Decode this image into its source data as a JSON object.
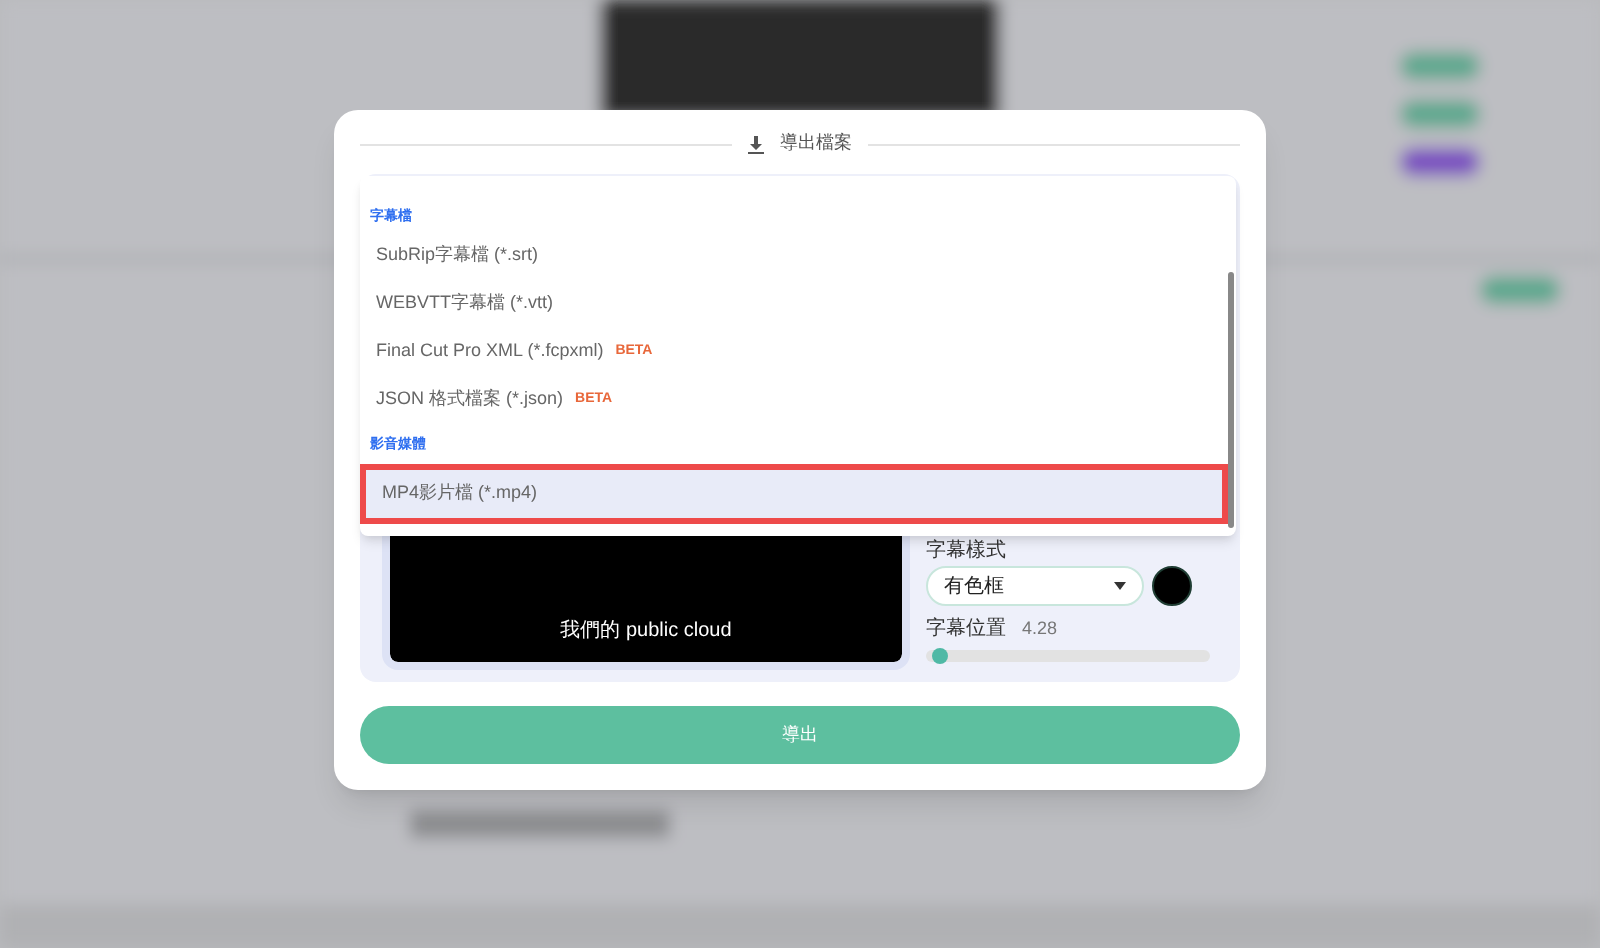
{
  "dialog": {
    "title": "導出檔案",
    "menu": {
      "groups": [
        {
          "label": "字幕檔",
          "items": [
            {
              "label": "SubRip字幕檔 (*.srt)",
              "selected": false
            },
            {
              "label": "WEBVTT字幕檔 (*.vtt)",
              "selected": false
            },
            {
              "label": "Final Cut Pro XML (*.fcpxml)",
              "badge": "BETA",
              "selected": false
            },
            {
              "label": "JSON 格式檔案 (*.json)",
              "badge": "BETA",
              "selected": false
            }
          ]
        },
        {
          "label": "影音媒體",
          "items": [
            {
              "label": "MP4影片檔 (*.mp4)",
              "selected": true
            }
          ]
        }
      ]
    },
    "preview": {
      "caption": "我們的 public cloud"
    },
    "style": {
      "label": "字幕樣式",
      "value": "有色框",
      "color": "#000000"
    },
    "position": {
      "label": "字幕位置",
      "value": "4.28",
      "level": 0.02
    },
    "export_button": "導出"
  }
}
